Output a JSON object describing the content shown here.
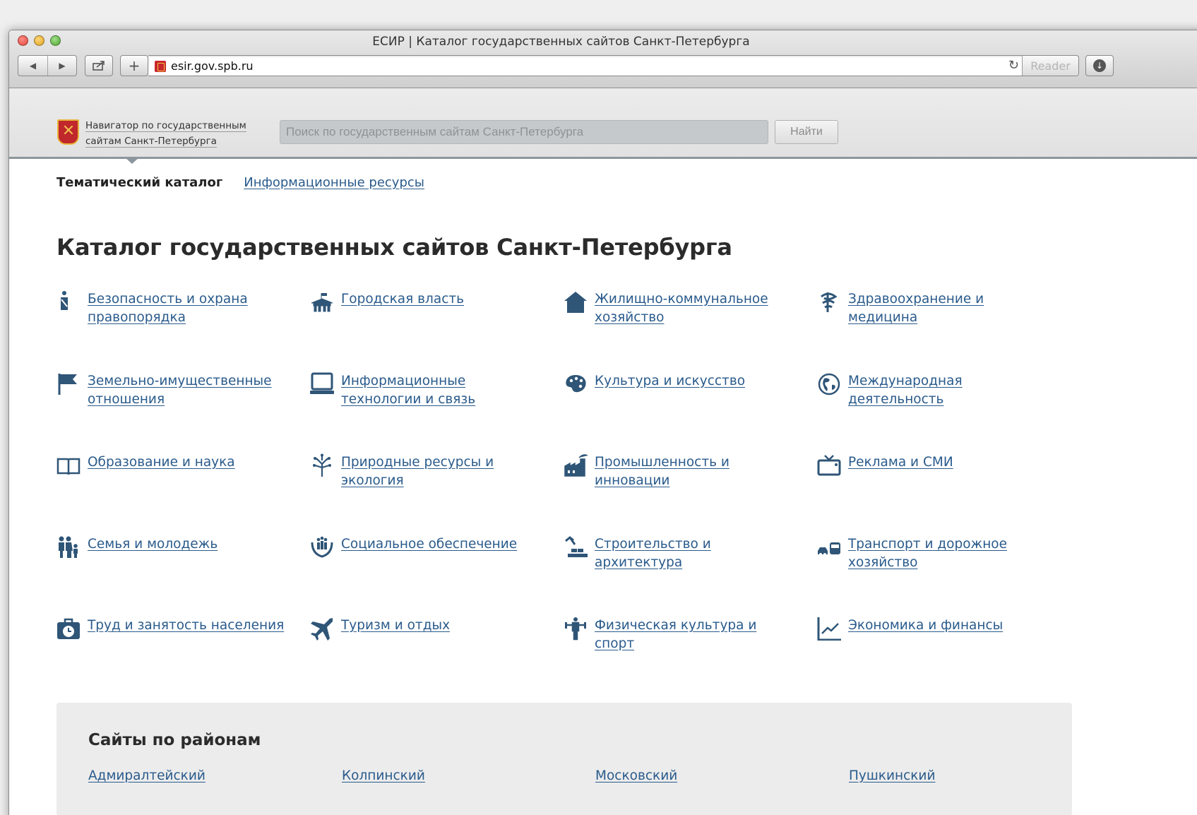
{
  "window": {
    "title": "ЕСИР | Каталог государственных сайтов Санкт-Петербурга"
  },
  "toolbar": {
    "url": "esir.gov.spb.ru",
    "reader_label": "Reader"
  },
  "site_header": {
    "portal_line1": "Навигатор по государственным",
    "portal_line2": "сайтам Санкт-Петербурга",
    "search_placeholder": "Поиск по государственным сайтам Санкт-Петербурга",
    "search_button": "Найти"
  },
  "subnav": {
    "thematic": "Тематический каталог",
    "resources": "Информационные ресурсы"
  },
  "catalog": {
    "title": "Каталог государственных сайтов Санкт-Петербурга",
    "items": [
      {
        "label": "Безопасность и охрана правопорядка",
        "icon": "police-icon"
      },
      {
        "label": "Городская власть",
        "icon": "government-building-icon"
      },
      {
        "label": "Жилищно-коммунальное хозяйство",
        "icon": "house-icon"
      },
      {
        "label": "Здравоохранение и медицина",
        "icon": "caduceus-icon"
      },
      {
        "label": "Земельно-имущественные отношения",
        "icon": "flag-icon"
      },
      {
        "label": "Информационные технологии и связь",
        "icon": "laptop-icon"
      },
      {
        "label": "Культура и искусство",
        "icon": "palette-icon"
      },
      {
        "label": "Международная деятельность",
        "icon": "globe-icon"
      },
      {
        "label": "Образование и наука",
        "icon": "book-icon"
      },
      {
        "label": "Природные ресурсы и экология",
        "icon": "tree-icon"
      },
      {
        "label": "Промышленность и инновации",
        "icon": "factory-icon"
      },
      {
        "label": "Реклама и СМИ",
        "icon": "tv-icon"
      },
      {
        "label": "Семья и молодежь",
        "icon": "family-icon"
      },
      {
        "label": "Социальное обеспечение",
        "icon": "hands-people-icon"
      },
      {
        "label": "Строительство и архитектура",
        "icon": "construction-icon"
      },
      {
        "label": "Транспорт и дорожное хозяйство",
        "icon": "car-bus-icon"
      },
      {
        "label": "Труд и занятость населения",
        "icon": "briefcase-clock-icon"
      },
      {
        "label": "Туризм и отдых",
        "icon": "airplane-icon"
      },
      {
        "label": "Физическая культура и спорт",
        "icon": "weightlifter-icon"
      },
      {
        "label": "Экономика и финансы",
        "icon": "chart-line-icon"
      }
    ]
  },
  "districts": {
    "title": "Сайты по районам",
    "items": [
      "Адмиралтейский",
      "Колпинский",
      "Московский",
      "Пушкинский"
    ]
  }
}
